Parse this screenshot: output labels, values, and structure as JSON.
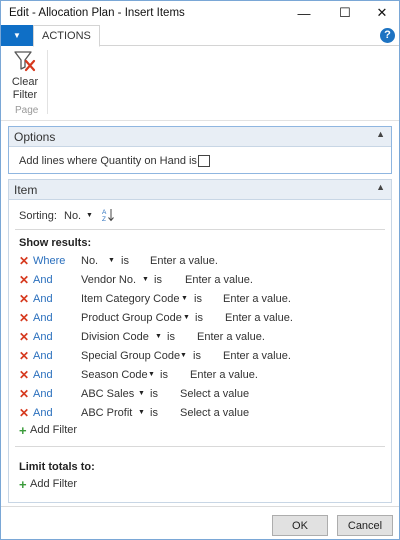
{
  "window": {
    "title": "Edit - Allocation Plan - Insert Items",
    "minimize": "—",
    "maximize": "☐",
    "close": "✕"
  },
  "ribbon": {
    "tab_actions": "ACTIONS",
    "help": "?",
    "clear_filter_label_1": "Clear",
    "clear_filter_label_2": "Filter",
    "group_label": "Page"
  },
  "options": {
    "title": "Options",
    "add_lines_label": "Add lines where Quantity on Hand is 0:",
    "add_lines_checked": false
  },
  "item": {
    "title": "Item",
    "sorting_label": "Sorting:",
    "sorting_value": "No.",
    "show_results_label": "Show results:",
    "filters": [
      {
        "connector": "Where",
        "field": "No.",
        "op": "is",
        "value": "Enter a value."
      },
      {
        "connector": "And",
        "field": "Vendor No.",
        "op": "is",
        "value": "Enter a value."
      },
      {
        "connector": "And",
        "field": "Item Category Code",
        "op": "is",
        "value": "Enter a value."
      },
      {
        "connector": "And",
        "field": "Product Group Code",
        "op": "is",
        "value": "Enter a value."
      },
      {
        "connector": "And",
        "field": "Division Code",
        "op": "is",
        "value": "Enter a value."
      },
      {
        "connector": "And",
        "field": "Special Group Code",
        "op": "is",
        "value": "Enter a value."
      },
      {
        "connector": "And",
        "field": "Season Code",
        "op": "is",
        "value": "Enter a value."
      },
      {
        "connector": "And",
        "field": "ABC Sales",
        "op": "is",
        "value": "Select a value"
      },
      {
        "connector": "And",
        "field": "ABC Profit",
        "op": "is",
        "value": "Select a value"
      }
    ],
    "add_filter_label": "Add Filter",
    "limit_totals_label": "Limit totals to:",
    "limit_add_filter_label": "Add Filter"
  },
  "buttons": {
    "ok": "OK",
    "cancel": "Cancel"
  },
  "colors": {
    "accent": "#0f6fc6",
    "link": "#2a6fbd",
    "remove": "#d6391e",
    "add": "#3a9b3a"
  }
}
